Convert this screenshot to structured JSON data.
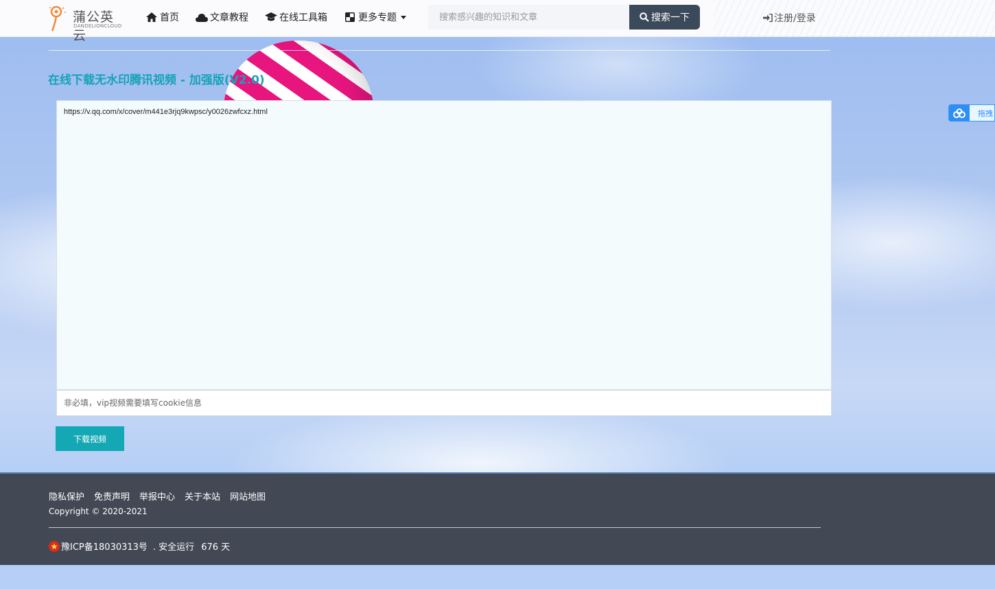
{
  "header": {
    "logo": {
      "name": "蒲公英云",
      "sub": "DANDELIONCLOUD",
      "icon": "dandelion-logo"
    },
    "nav": [
      {
        "label": "首页",
        "icon": "home-icon"
      },
      {
        "label": "文章教程",
        "icon": "cloud-icon"
      },
      {
        "label": "在线工具箱",
        "icon": "graduation-cap-icon"
      },
      {
        "label": "更多专题",
        "icon": "grid-icon",
        "dropdown": true
      }
    ],
    "search": {
      "placeholder": "搜索感兴趣的知识和文章",
      "button_label": "搜索一下"
    },
    "login_label": "注册/登录"
  },
  "main": {
    "title": "在线下载无水印腾讯视频 - 加强版(V2.0)",
    "url_value": "https://v.qq.com/x/cover/m441e3rjq9kwpsc/y0026zwfcxz.html",
    "cookie_placeholder": "非必填，vip视频需要填写cookie信息",
    "download_label": "下载视频"
  },
  "side_widget": {
    "label": "拖拽",
    "icon": "baidu-icon"
  },
  "footer": {
    "links": [
      "隐私保护",
      "免责声明",
      "举报中心",
      "关于本站",
      "网站地图"
    ],
    "copyright": "Copyright © 2020-2021",
    "icp": "豫ICP备18030313号",
    "runtime_label": ". 安全运行",
    "runtime_days": "676 天"
  },
  "colors": {
    "accent": "#17a2b8",
    "button": "#14a8b4",
    "footer_bg": "#424955",
    "search_btn": "#3b4a5a"
  }
}
